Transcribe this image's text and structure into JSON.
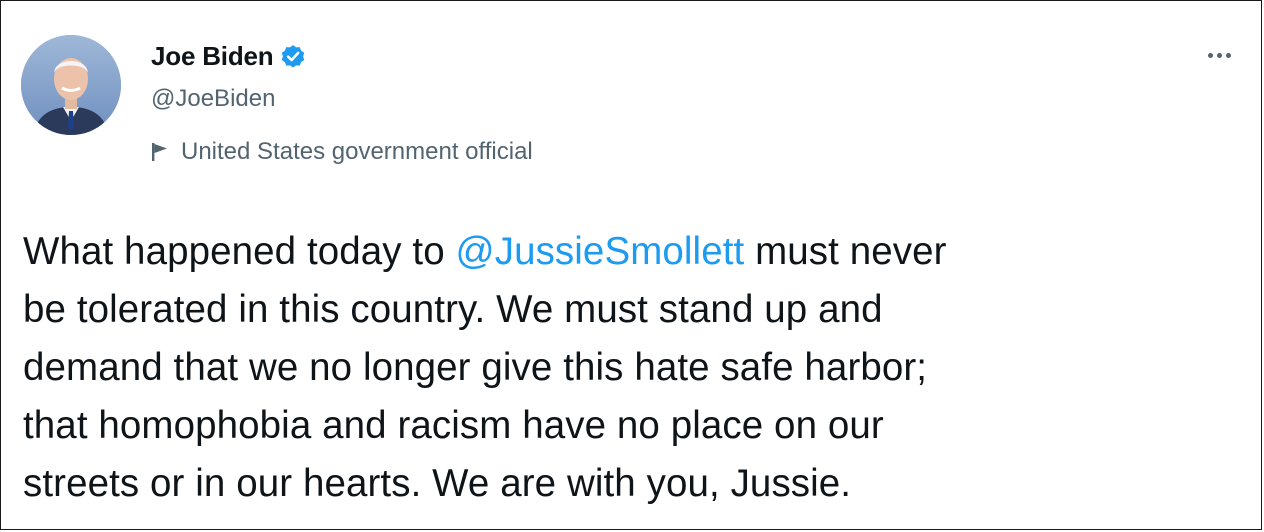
{
  "author": {
    "name": "Joe Biden",
    "handle": "@JoeBiden",
    "label": "United States government official",
    "verified": true
  },
  "tweet": {
    "line1_before": "What happened today to ",
    "mention": "@JussieSmollett",
    "line1_after": " must never",
    "line2": "be tolerated in this country. We must stand up and",
    "line3": "demand that we no longer give this hate safe harbor;",
    "line4": "that homophobia and racism have no place on our",
    "line5": "streets or in our hearts. We are with you, Jussie."
  },
  "icons": {
    "verified": "verified-badge-icon",
    "label": "flag-icon",
    "more": "more-options-icon"
  },
  "colors": {
    "text": "#0f1419",
    "secondary": "#536471",
    "accent": "#1d9bf0"
  }
}
